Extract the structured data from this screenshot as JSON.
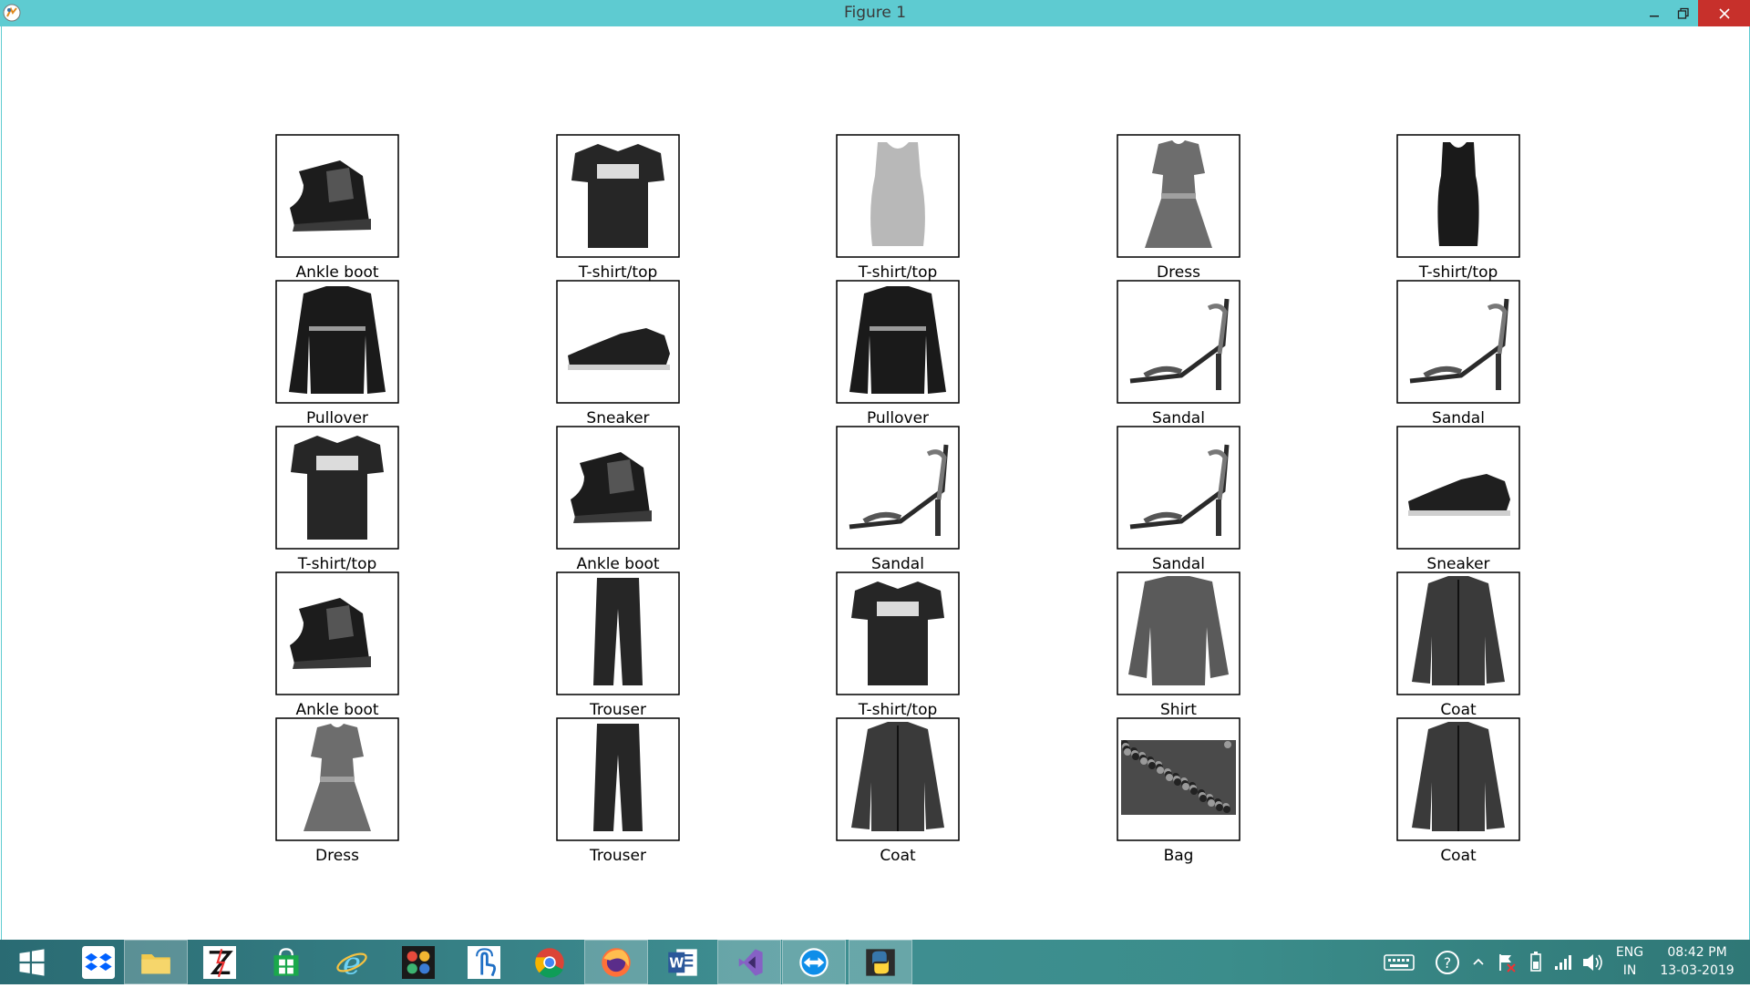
{
  "window": {
    "title": "Figure 1",
    "minimize_icon": "minimize-icon",
    "maximize_icon": "restore-icon",
    "close_icon": "close-icon"
  },
  "figure": {
    "rows": 5,
    "cols": 5,
    "items": [
      {
        "label": "Ankle boot",
        "icon": "ankle-boot-image"
      },
      {
        "label": "T-shirt/top",
        "icon": "tshirt-image"
      },
      {
        "label": "T-shirt/top",
        "icon": "tank-top-image"
      },
      {
        "label": "Dress",
        "icon": "dress-image"
      },
      {
        "label": "T-shirt/top",
        "icon": "tank-top-dark-image"
      },
      {
        "label": "Pullover",
        "icon": "pullover-image"
      },
      {
        "label": "Sneaker",
        "icon": "sneaker-image"
      },
      {
        "label": "Pullover",
        "icon": "pullover-image"
      },
      {
        "label": "Sandal",
        "icon": "sandal-image"
      },
      {
        "label": "Sandal",
        "icon": "sandal-image"
      },
      {
        "label": "T-shirt/top",
        "icon": "tshirt-image"
      },
      {
        "label": "Ankle boot",
        "icon": "ankle-boot-image"
      },
      {
        "label": "Sandal",
        "icon": "sandal-image"
      },
      {
        "label": "Sandal",
        "icon": "sandal-image"
      },
      {
        "label": "Sneaker",
        "icon": "sneaker-image"
      },
      {
        "label": "Ankle boot",
        "icon": "ankle-boot-image"
      },
      {
        "label": "Trouser",
        "icon": "trouser-image"
      },
      {
        "label": "T-shirt/top",
        "icon": "tshirt-image"
      },
      {
        "label": "Shirt",
        "icon": "shirt-image"
      },
      {
        "label": "Coat",
        "icon": "coat-image"
      },
      {
        "label": "Dress",
        "icon": "dress-image"
      },
      {
        "label": "Trouser",
        "icon": "trouser-image"
      },
      {
        "label": "Coat",
        "icon": "coat-image"
      },
      {
        "label": "Bag",
        "icon": "bag-image"
      },
      {
        "label": "Coat",
        "icon": "coat-image"
      }
    ]
  },
  "taskbar": {
    "apps": [
      {
        "name": "start-button",
        "icon": "windows-logo-icon"
      },
      {
        "name": "dropbox",
        "icon": "dropbox-icon"
      },
      {
        "name": "file-explorer",
        "icon": "folder-icon"
      },
      {
        "name": "app-z",
        "icon": "z-app-icon"
      },
      {
        "name": "store",
        "icon": "store-icon"
      },
      {
        "name": "internet-explorer",
        "icon": "ie-icon"
      },
      {
        "name": "photos-app",
        "icon": "photos-icon"
      },
      {
        "name": "touch-app",
        "icon": "touch-icon"
      },
      {
        "name": "chrome",
        "icon": "chrome-icon"
      },
      {
        "name": "firefox",
        "icon": "firefox-icon"
      },
      {
        "name": "word",
        "icon": "word-icon"
      },
      {
        "name": "visual-studio",
        "icon": "visual-studio-icon"
      },
      {
        "name": "teamviewer",
        "icon": "teamviewer-icon"
      },
      {
        "name": "python",
        "icon": "python-icon"
      }
    ],
    "tray": {
      "language_line1": "ENG",
      "language_line2": "IN",
      "time": "08:42 PM",
      "date": "13-03-2019"
    }
  }
}
